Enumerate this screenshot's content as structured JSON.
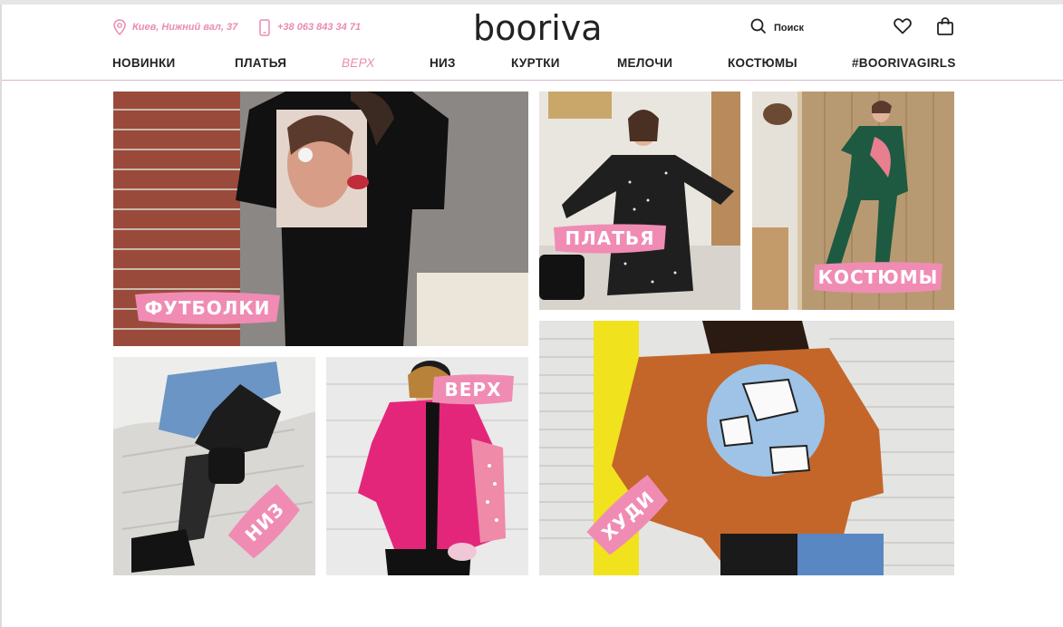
{
  "header": {
    "address": "Киев, Нижний вал, 37",
    "phone": "+38 063 843 34 71",
    "logo": "booriva",
    "search_label": "Поиск"
  },
  "nav": [
    {
      "label": "НОВИНКИ",
      "active": false
    },
    {
      "label": "ПЛАТЬЯ",
      "active": false
    },
    {
      "label": "ВЕРХ",
      "active": true
    },
    {
      "label": "НИЗ",
      "active": false
    },
    {
      "label": "КУРТКИ",
      "active": false
    },
    {
      "label": "МЕЛОЧИ",
      "active": false
    },
    {
      "label": "КОСТЮМЫ",
      "active": false
    },
    {
      "label": "#BOORIVAGIRLS",
      "active": false
    }
  ],
  "categories": {
    "tshirts": "ФУТБОЛКИ",
    "dresses": "ПЛАТЬЯ",
    "suits": "КОСТЮМЫ",
    "bottoms": "НИЗ",
    "tops": "ВЕРХ",
    "hoodies": "ХУДИ"
  },
  "colors": {
    "accent": "#f08cb4",
    "text": "#222222"
  }
}
